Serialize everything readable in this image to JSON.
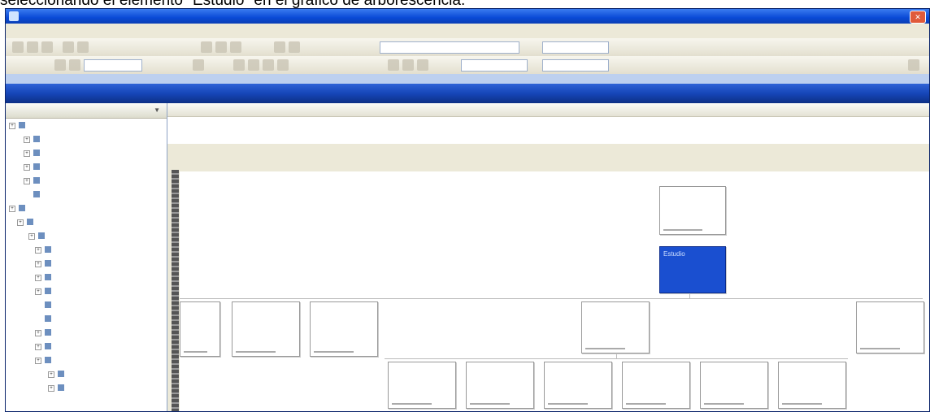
{
  "caption": "seleccionando el elemento \"Estudio\" en el gráfico de arborescencia.",
  "window": {
    "title": ""
  },
  "menu": [
    "",
    "",
    "",
    ""
  ],
  "panel": {
    "title": ""
  },
  "sidebar": {
    "header": ""
  },
  "tree": [
    {
      "label": ""
    },
    {
      "label": ""
    },
    {
      "label": ""
    },
    {
      "label": ""
    },
    {
      "label": ""
    },
    {
      "label": ""
    },
    {
      "label": ""
    },
    {
      "label": ""
    },
    {
      "label": ""
    },
    {
      "label": ""
    },
    {
      "label": ""
    },
    {
      "label": ""
    },
    {
      "label": ""
    },
    {
      "label": ""
    },
    {
      "label": ""
    },
    {
      "label": ""
    },
    {
      "label": ""
    },
    {
      "label": ""
    },
    {
      "label": ""
    },
    {
      "label": ""
    }
  ],
  "grid": {
    "columns": [
      "",
      "",
      "",
      "",
      "",
      ""
    ],
    "row": [
      "",
      "",
      "",
      "",
      "",
      ""
    ]
  },
  "chart": {
    "root": {
      "label": ""
    },
    "selected": {
      "label": "Estudio"
    },
    "level2": [
      {
        "label": ""
      },
      {
        "label": ""
      },
      {
        "label": ""
      },
      {
        "label": ""
      },
      {
        "label": ""
      }
    ],
    "level3": [
      {
        "label": ""
      },
      {
        "label": ""
      },
      {
        "label": ""
      },
      {
        "label": ""
      },
      {
        "label": ""
      },
      {
        "label": ""
      }
    ]
  },
  "colors": {
    "selection": "#1a4fd0",
    "titlebar": "#0a4ad6"
  }
}
